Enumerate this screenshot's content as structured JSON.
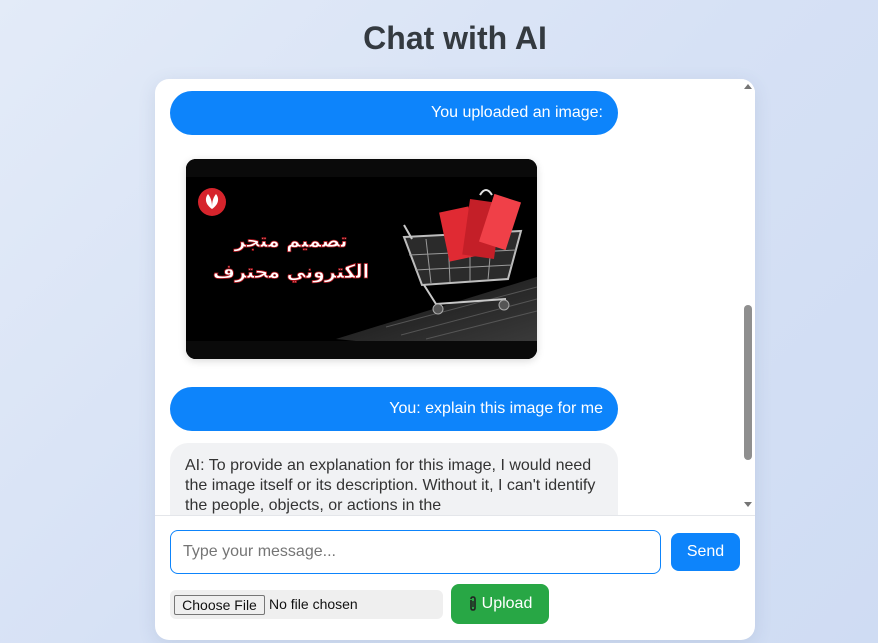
{
  "page": {
    "title": "Chat with AI"
  },
  "messages": [
    {
      "role": "user",
      "text": "You uploaded an image:"
    },
    {
      "role": "image",
      "caption_line1": "تصميم متجر",
      "caption_line2": "الكتروني محترف",
      "logo_icon": "leaf-logo-icon"
    },
    {
      "role": "user",
      "text": "You: explain this image for me"
    },
    {
      "role": "ai",
      "text": "AI: To provide an explanation for this image, I would need the image itself or its description. Without it, I can't identify the people, objects, or actions in the"
    }
  ],
  "composer": {
    "placeholder": "Type your message...",
    "value": "",
    "send_label": "Send",
    "choose_file_label": "Choose File",
    "file_status": "No file chosen",
    "upload_label": "Upload",
    "upload_icon": "paperclip-icon"
  },
  "colors": {
    "user_bubble": "#0d84fb",
    "ai_bubble": "#f1f2f4",
    "send_button": "#0d84fb",
    "upload_button": "#28a745"
  }
}
